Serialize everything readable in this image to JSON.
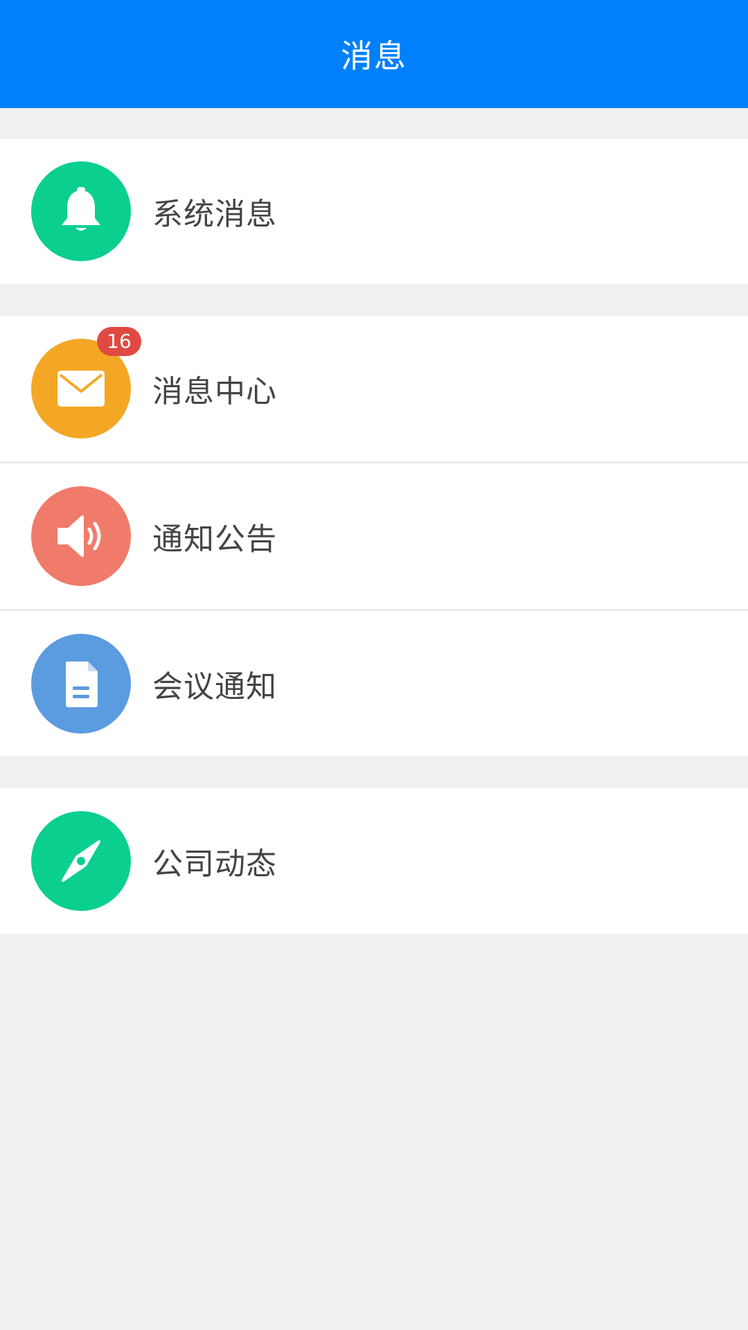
{
  "header": {
    "title": "消息"
  },
  "colors": {
    "header_bg": "#0080fc",
    "system_icon_bg": "#0acf8f",
    "message_center_icon_bg": "#f4a724",
    "notice_icon_bg": "#f07b6a",
    "meeting_icon_bg": "#5b9be0",
    "company_icon_bg": "#0acf8f",
    "badge_bg": "#e04a43"
  },
  "items": {
    "system": {
      "label": "系统消息",
      "icon": "bell-icon"
    },
    "message_center": {
      "label": "消息中心",
      "icon": "envelope-icon",
      "badge": "16"
    },
    "notice": {
      "label": "通知公告",
      "icon": "speaker-icon"
    },
    "meeting": {
      "label": "会议通知",
      "icon": "document-icon"
    },
    "company": {
      "label": "公司动态",
      "icon": "compass-icon"
    }
  }
}
